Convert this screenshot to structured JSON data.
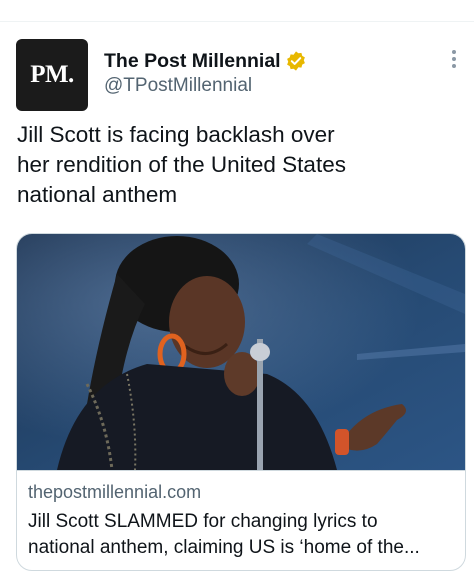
{
  "tweet": {
    "author": {
      "avatar_text": "PM.",
      "display_name": "The Post Millennial",
      "handle": "@TPostMillennial",
      "verified_badge_color": "#e8b800"
    },
    "text_lines": [
      "Jill Scott is facing backlash over",
      "her rendition of the United States",
      "national anthem"
    ],
    "card": {
      "image": "singer-performing-at-microphone",
      "domain": "thepostmillennial.com",
      "title_lines": [
        "Jill Scott SLAMMED for changing lyrics to",
        "national anthem, claiming US is ‘home of the..."
      ]
    }
  },
  "icons": {
    "verified": "verified-badge-icon",
    "more": "more-options-icon"
  },
  "colors": {
    "text_primary": "#0f1419",
    "text_secondary": "#536471",
    "border": "#cfd9de",
    "avatar_bg": "#1b1b1b"
  }
}
